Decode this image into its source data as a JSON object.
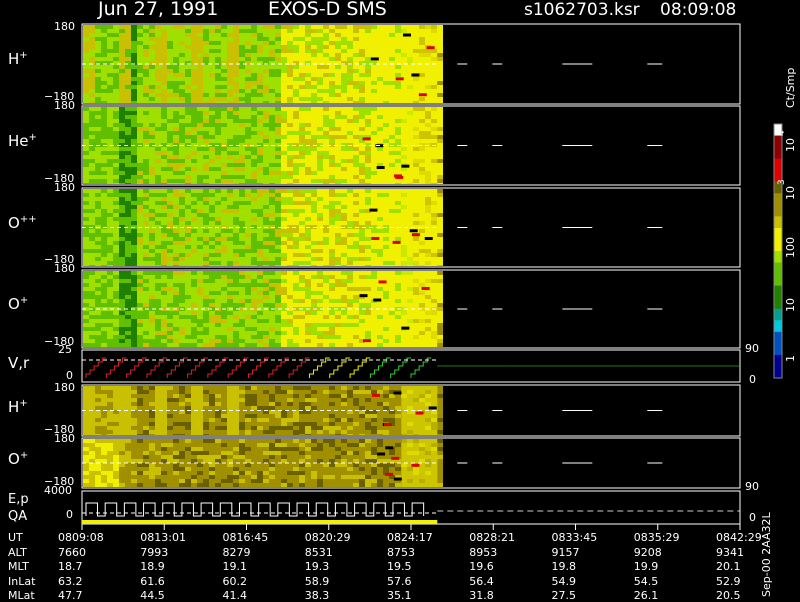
{
  "header": {
    "date": "Jun 27, 1991",
    "mission": "EXOS-D SMS",
    "filename": "s1062703.ksr",
    "time": "08:09:08"
  },
  "panels": [
    {
      "id": "h-plus",
      "species": "H",
      "charge": "+",
      "ymax": "180",
      "ymin": "−180"
    },
    {
      "id": "he-plus",
      "species": "He",
      "charge": "+",
      "ymax": "180",
      "ymin": "−180"
    },
    {
      "id": "o-plus-plus",
      "species": "O",
      "charge": "++",
      "ymax": "180",
      "ymin": "−180"
    },
    {
      "id": "o-plus",
      "species": "O",
      "charge": "+",
      "ymax": "180",
      "ymin": "−180"
    },
    {
      "id": "vr",
      "label": "V,r",
      "ymax": "25",
      "ymin": "0",
      "rmax": "90",
      "rmin": "0"
    },
    {
      "id": "h-plus-2",
      "species": "H",
      "charge": "+",
      "ymax": "180",
      "ymin": "−180"
    },
    {
      "id": "o-plus-2",
      "species": "O",
      "charge": "+",
      "ymax": "180",
      "ymin": "−180"
    },
    {
      "id": "ep",
      "label": "E,p",
      "label2": "QA",
      "ymax": "4000",
      "ymin": "0",
      "rmax": "90",
      "rmin": "0"
    }
  ],
  "colorbar": {
    "title": "Ct/Smp",
    "ticks": [
      "10",
      "4",
      "10",
      "3",
      "100",
      "10",
      "1"
    ],
    "colors": {
      "white": "#ffffff",
      "red_dark": "#8b0000",
      "red": "#e00000",
      "olive_dark": "#6b6000",
      "olive": "#a09000",
      "yellow_dark": "#c8c000",
      "yellow": "#f0f000",
      "green_light": "#a0e000",
      "green": "#60c000",
      "green_dark": "#208000",
      "teal": "#00a090",
      "cyan": "#00c8e0",
      "blue": "#0050c0",
      "navy": "#000090"
    }
  },
  "footer": {
    "id": "Sep-00 2AA32L",
    "rows": [
      {
        "label": "UT",
        "values": [
          "0809:08",
          "0813:01",
          "0816:45",
          "0820:29",
          "0824:17",
          "0828:21",
          "0833:45",
          "0835:29",
          "0842:29"
        ]
      },
      {
        "label": "ALT",
        "values": [
          "7660",
          "7993",
          "8279",
          "8531",
          "8753",
          "8953",
          "9157",
          "9208",
          "9341"
        ]
      },
      {
        "label": "MLT",
        "values": [
          "18.7",
          "18.9",
          "19.1",
          "19.3",
          "19.5",
          "19.6",
          "19.8",
          "19.9",
          "20.1"
        ]
      },
      {
        "label": "InLat",
        "values": [
          "63.2",
          "61.6",
          "60.2",
          "58.9",
          "57.6",
          "56.4",
          "54.9",
          "54.5",
          "52.9"
        ]
      },
      {
        "label": "MLat",
        "values": [
          "47.7",
          "44.5",
          "41.4",
          "38.3",
          "35.1",
          "31.8",
          "27.5",
          "26.1",
          "20.5"
        ]
      }
    ]
  },
  "chart_data": {
    "type": "heatmap",
    "title": "Jun 27, 1991   EXOS-D SMS",
    "x_tick_labels": [
      "0809:08",
      "0813:01",
      "0816:45",
      "0820:29",
      "0824:17",
      "0828:21",
      "0833:45",
      "0835:29",
      "0842:29"
    ],
    "data_extent_fraction": 0.54,
    "color_scale": "log",
    "color_range": [
      1,
      10000
    ],
    "panels": [
      "H+",
      "He+",
      "O++",
      "O+",
      "V,r",
      "H+",
      "O+",
      "E,p QA"
    ],
    "pitch_angle_range": [
      -180,
      180
    ],
    "series_vr": {
      "name": "V,r",
      "ylim": [
        0,
        25
      ],
      "sawtooth_periods": 17
    },
    "series_ep": {
      "name": "E,p",
      "ylim": [
        0,
        4000
      ],
      "step_periods": 18
    }
  }
}
